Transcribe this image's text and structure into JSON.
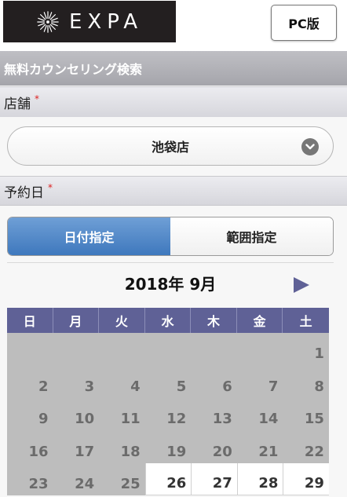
{
  "header": {
    "logo_text": "EXPA",
    "logo_icon": "starburst-icon",
    "pc_label": "PC版"
  },
  "section": {
    "title": "無料カウンセリング検索"
  },
  "store": {
    "label": "店舗",
    "required_mark": "*",
    "selected": "池袋店",
    "select_icon": "chevron-down-icon"
  },
  "booking": {
    "label": "予約日",
    "required_mark": "*",
    "tabs": [
      {
        "label": "日付指定",
        "active": true
      },
      {
        "label": "範囲指定",
        "active": false
      }
    ]
  },
  "calendar": {
    "month_label": "2018年 9月",
    "next_icon": "next-month-arrow-icon",
    "weekdays": [
      "日",
      "月",
      "火",
      "水",
      "木",
      "金",
      "土"
    ],
    "weeks": [
      [
        "",
        "",
        "",
        "",
        "",
        "",
        "1"
      ],
      [
        "2",
        "3",
        "4",
        "5",
        "6",
        "7",
        "8"
      ],
      [
        "9",
        "10",
        "11",
        "12",
        "13",
        "14",
        "15"
      ],
      [
        "16",
        "17",
        "18",
        "19",
        "20",
        "21",
        "22"
      ],
      [
        "23",
        "24",
        "25",
        "26",
        "27",
        "28",
        "29"
      ]
    ],
    "first_available_day": 26
  },
  "colors": {
    "header_bg": "#231f20",
    "weekday_header": "#5f6196",
    "active_tab": "#4a84c6",
    "disabled_day": "#bdbdbd",
    "required": "#dd2222"
  }
}
